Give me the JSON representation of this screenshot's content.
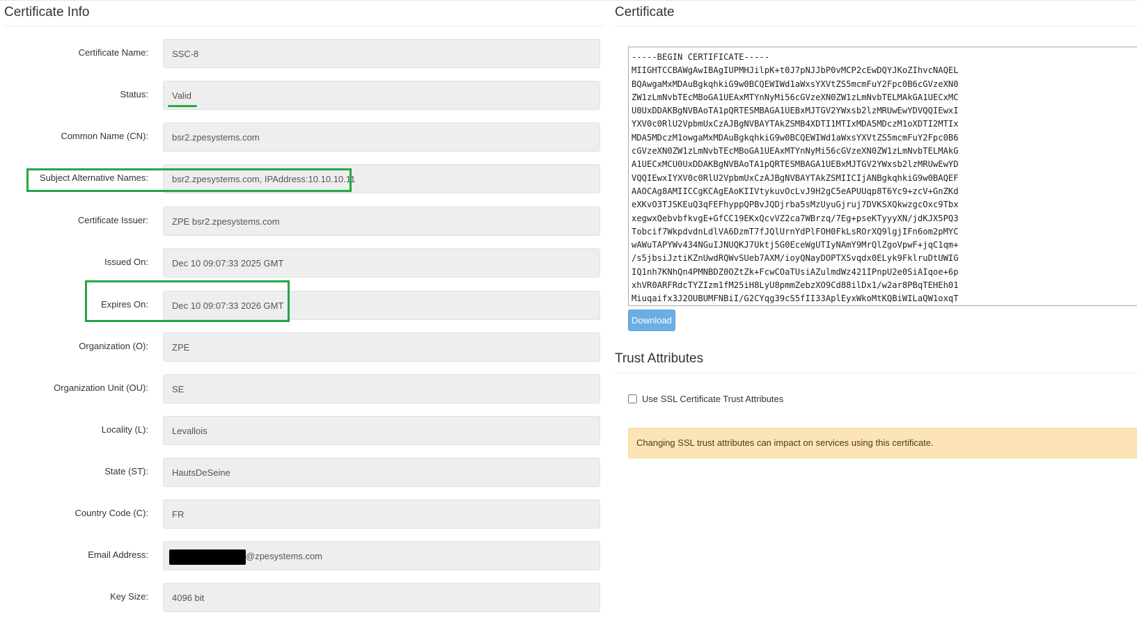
{
  "left_section": {
    "title": "Certificate Info"
  },
  "fields": [
    {
      "label": "Certificate Name:",
      "value": "SSC-8"
    },
    {
      "label": "Status:",
      "value": "Valid"
    },
    {
      "label": "Common Name (CN):",
      "value": "bsr2.zpesystems.com"
    },
    {
      "label": "Subject Alternative Names:",
      "value": "bsr2.zpesystems.com, IPAddress:10.10.10.11"
    },
    {
      "label": "Certificate Issuer:",
      "value": "ZPE bsr2.zpesystems.com"
    },
    {
      "label": "Issued On:",
      "value": "Dec 10 09:07:33 2025 GMT"
    },
    {
      "label": "Expires On:",
      "value": "Dec 10 09:07:33 2026 GMT"
    },
    {
      "label": "Organization (O):",
      "value": "ZPE"
    },
    {
      "label": "Organization Unit (OU):",
      "value": "SE"
    },
    {
      "label": "Locality (L):",
      "value": "Levallois"
    },
    {
      "label": "State (ST):",
      "value": "HautsDeSeine"
    },
    {
      "label": "Country Code (C):",
      "value": "FR"
    },
    {
      "label": "Email Address:",
      "value": "@zpesystems.com"
    },
    {
      "label": "Key Size:",
      "value": "4096 bit"
    }
  ],
  "certificate": {
    "title": "Certificate",
    "lines": [
      "-----BEGIN CERTIFICATE-----",
      "MIIGHTCCBAWgAwIBAgIUPMHJilpK+t0J7pNJJbP0vMCP2cEwDQYJKoZIhvcNAQEL",
      "BQAwgaMxMDAuBgkqhkiG9w0BCQEWIWd1aWxsYXVtZS5mcmFuY2Fpc0B6cGVzeXN0",
      "ZW1zLmNvbTEcMBoGA1UEAxMTYnNyMi56cGVzeXN0ZW1zLmNvbTELMAkGA1UECxMC",
      "U0UxDDAKBgNVBAoTA1pQRTESMBAGA1UEBxMJTGV2YWxsb2lzMRUwEwYDVQQIEwxI",
      "YXV0c0RlU2VpbmUxCzAJBgNVBAYTAkZSMB4XDTI1MTIxMDA5MDczM1oXDTI2MTIx",
      "MDA5MDczM1owgaMxMDAuBgkqhkiG9w0BCQEWIWd1aWxsYXVtZS5mcmFuY2Fpc0B6",
      "cGVzeXN0ZW1zLmNvbTEcMBoGA1UEAxMTYnNyMi56cGVzeXN0ZW1zLmNvbTELMAkG",
      "A1UECxMCU0UxDDAKBgNVBAoTA1pQRTESMBAGA1UEBxMJTGV2YWxsb2lzMRUwEwYD",
      "VQQIEwxIYXV0c0RlU2VpbmUxCzAJBgNVBAYTAkZSMIICIjANBgkqhkiG9w0BAQEF",
      "AAOCAg8AMIICCgKCAgEAoKIIVtykuvOcLvJ9H2gC5eAPUUqp8T6Yc9+zcV+GnZKd",
      "eXKvO3TJSKEuQ3qFEFhyppQPBvJQDjrba5sMzUyuGjruj7DVKSXQkwzgcOxc9Tbx",
      "xegwxQebvbfkvgE+GfCC19EKxQcvVZ2ca7WBrzq/7Eg+pseKTyyyXN/jdKJX5PQ3",
      "Tobcif7WkpdvdnLdlVA6DzmT7fJQlUrnYdPlFOH0FkLsROrXQ9lgjIFn6om2pMYC",
      "wAWuTAPYWv434NGuIJNUQKJ7Uktj5G0EceWgUTIyNAmY9MrQlZgoVpwF+jqC1qm+",
      "/s5jbsiJztiKZnUwdRQWvSUeb7AXM/ioyQNayDOPTXSvqdx0ELyk9FklruDtUWIG",
      "IQ1nh7KNhQn4PMNBDZ0OZtZk+FcwCOaTUsiAZulmdWz421IPnpU2e0SiAIqoe+6p",
      "xhVR0ARFRdcTYZIzm1fM25iH8LyU8pmmZebzXO9Cd88ilDx1/w2ar8PBqTEHEh01",
      "Miuqaifx3J2OUBUMFNBiI/G2CYqg39cS5fII33AplEyxWkoMtKQBiWILaQW1oxqT"
    ],
    "download_label": "Download"
  },
  "trust": {
    "title": "Trust Attributes",
    "checkbox_label": "Use SSL Certificate Trust Attributes",
    "checked": false,
    "warning": "Changing SSL trust attributes can impact on services using this certificate."
  },
  "colors": {
    "highlight": "#21a646",
    "status_valid": "#22aa44",
    "download_button": "#6aaee3",
    "warning_background": "#fce4b6"
  }
}
